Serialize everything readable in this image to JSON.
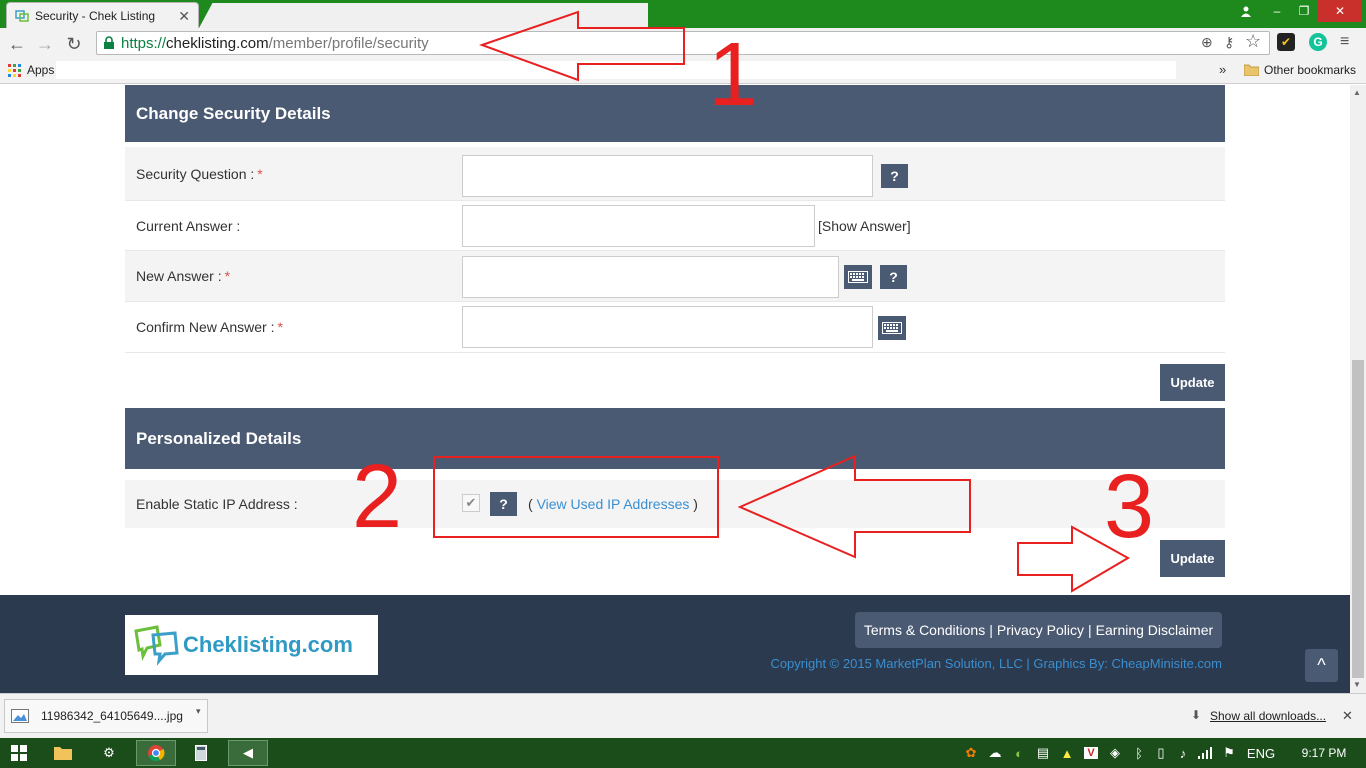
{
  "browser": {
    "tab_title": "Security - Chek Listing",
    "url_scheme": "https://",
    "url_host": "cheklisting.com",
    "url_path": "/member/profile/security",
    "apps_label": "Apps",
    "bookmarks_overflow": "»",
    "other_bookmarks": "Other bookmarks"
  },
  "security_section": {
    "title": "Change Security Details",
    "question_label": "Security Question :",
    "current_answer_label": "Current Answer :",
    "show_answer_link": "[Show Answer]",
    "new_answer_label": "New Answer :",
    "confirm_answer_label": "Confirm New Answer :",
    "required_mark": "*",
    "help_label": "?",
    "update_label": "Update"
  },
  "personalized_section": {
    "title": "Personalized Details",
    "static_ip_label": "Enable Static IP Address :",
    "static_ip_enabled": true,
    "view_ip_open": "(",
    "view_ip_link": "View Used IP Addresses",
    "view_ip_close": ")",
    "help_label": "?",
    "update_label": "Update"
  },
  "footer": {
    "logo_text": "Cheklisting.com",
    "links": [
      "Terms & Conditions",
      "Privacy Policy",
      "Earning Disclaimer"
    ],
    "separator": "|",
    "copyright": "Copyright © 2015 MarketPlan Solution, LLC | Graphics By: CheapMinisite.com",
    "to_top": "^"
  },
  "downloads": {
    "file_name": "11986342_64105649....jpg",
    "show_all": "Show all downloads..."
  },
  "taskbar": {
    "language": "ENG",
    "time": "9:17 PM"
  },
  "annotations": {
    "one": "1",
    "two": "2",
    "three": "3",
    "color": "#e8201f"
  },
  "colors": {
    "section_header": "#4b5a73",
    "footer_bg": "#2b3a4f",
    "link": "#3a8fd1",
    "titlebar": "#1e8a1e"
  }
}
